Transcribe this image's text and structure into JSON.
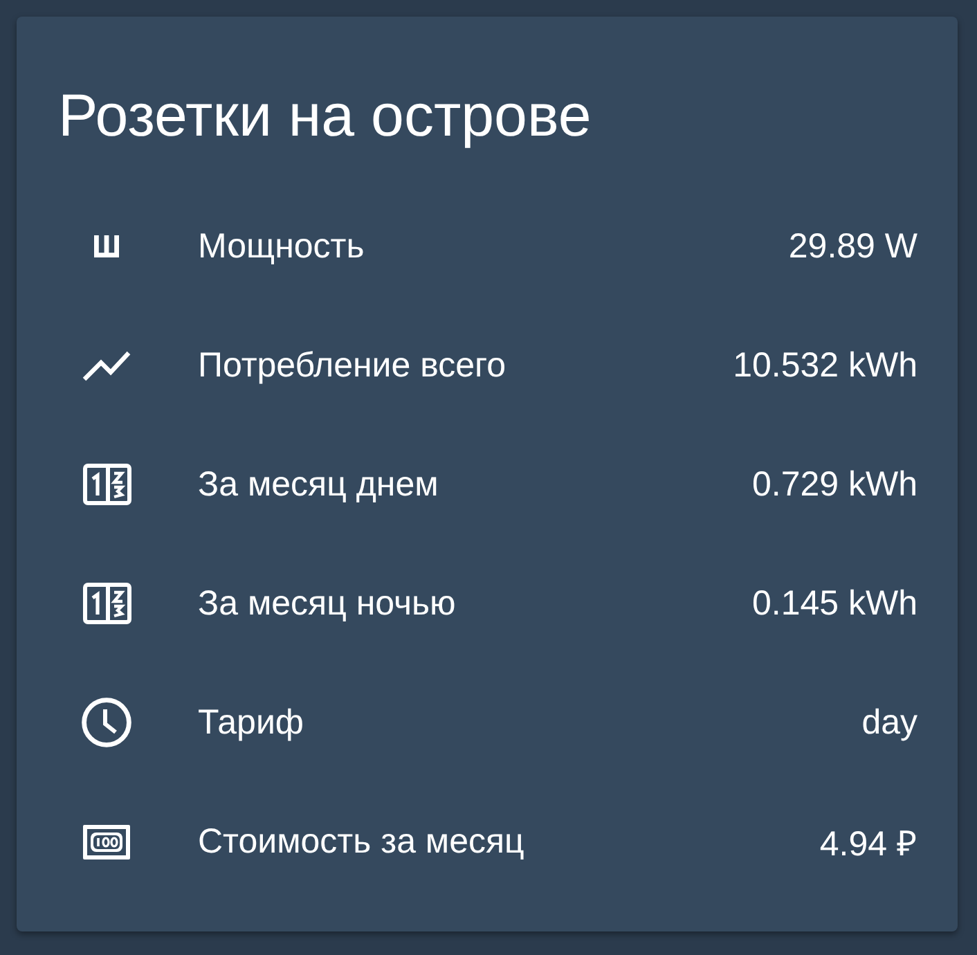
{
  "card": {
    "title": "Розетки на острове"
  },
  "rows": [
    {
      "kind": "prongs",
      "label": "Мощность",
      "value": "29.89 W"
    },
    {
      "kind": "chart",
      "label": "Потребление всего",
      "value": "10.532 kWh"
    },
    {
      "kind": "counter",
      "label": "За месяц днем",
      "value": "0.729 kWh"
    },
    {
      "kind": "counter",
      "label": "За месяц ночью",
      "value": "0.145 kWh"
    },
    {
      "kind": "clock",
      "label": "Тариф",
      "value": "day"
    },
    {
      "kind": "cash",
      "label": "Стоимость за месяц",
      "value": "4.94 ₽"
    }
  ]
}
